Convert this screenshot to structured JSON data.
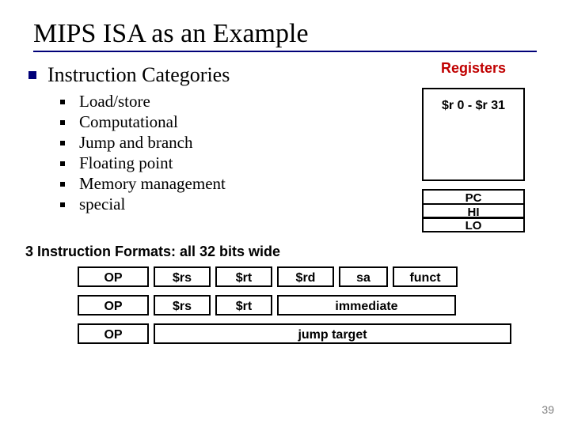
{
  "title": "MIPS ISA as an Example",
  "top_line": "Instruction Categories",
  "sub_items": [
    "Load/store",
    "Computational",
    "Jump and branch",
    "Floating point",
    "Memory management",
    "special"
  ],
  "registers": {
    "heading": "Registers",
    "range": "$r 0 - $r 31",
    "special": [
      "PC",
      "HI",
      "LO"
    ]
  },
  "formats_heading": "3 Instruction Formats: all 32 bits wide",
  "formats": {
    "row1": {
      "op": "OP",
      "rs": "$rs",
      "rt": "$rt",
      "rd": "$rd",
      "sa": "sa",
      "funct": "funct"
    },
    "row2": {
      "op": "OP",
      "rs": "$rs",
      "rt": "$rt",
      "imm": "immediate"
    },
    "row3": {
      "op": "OP",
      "target": "jump target"
    }
  },
  "slide_number": "39"
}
